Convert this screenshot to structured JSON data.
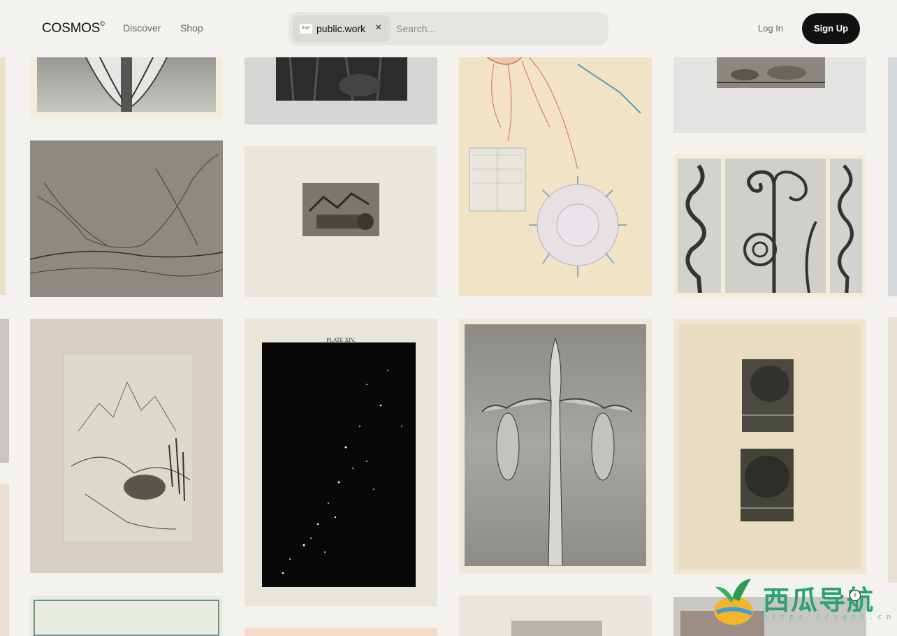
{
  "header": {
    "logo": "COSMOS",
    "logo_mark": "©",
    "nav": [
      {
        "label": "Discover"
      },
      {
        "label": "Shop"
      }
    ],
    "search": {
      "chip_label": "public.work",
      "chip_icon_text": "P.W°",
      "chip_close": "×",
      "placeholder": "Search..."
    },
    "login": "Log In",
    "signup": "Sign Up"
  },
  "artworks": [
    {
      "name": "botanical-bulb-photo",
      "plate_text": ""
    },
    {
      "name": "forest-etching",
      "plate_text": ""
    },
    {
      "name": "jellyfish-illustration",
      "plate_text": ""
    },
    {
      "name": "landscape-etching-small",
      "plate_text": ""
    },
    {
      "name": "mountain-valley-sketch",
      "plate_text": ""
    },
    {
      "name": "ruins-etching",
      "plate_text": ""
    },
    {
      "name": "tendril-spirals-photo",
      "plate_text": ""
    },
    {
      "name": "alpine-etching",
      "plate_text": ""
    },
    {
      "name": "star-plate",
      "plate_text": "PLATE XIV."
    },
    {
      "name": "plant-bud-photo",
      "plate_text": ""
    },
    {
      "name": "two-landscape-etchings",
      "plate_text": ""
    }
  ],
  "watermark": {
    "title": "西瓜导航",
    "url": "https://xgdh.cn",
    "info": "i"
  },
  "colors": {
    "background": "#f4f2ef",
    "signup_bg": "#111111",
    "search_bg": "#e7e5e2"
  }
}
